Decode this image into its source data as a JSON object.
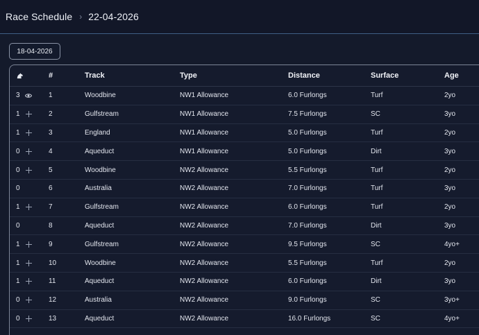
{
  "header": {
    "title": "Race Schedule",
    "separator": "›",
    "date": "22-04-2026"
  },
  "filter": {
    "date": "18-04-2026"
  },
  "table": {
    "columns": [
      "",
      "#",
      "Track",
      "Type",
      "Distance",
      "Surface",
      "Age"
    ],
    "rows": [
      {
        "count": "3",
        "icon": "eye-icon",
        "num": "1",
        "track": "Woodbine",
        "type": "NW1 Allowance",
        "distance": "6.0 Furlongs",
        "surface": "Turf",
        "age": "2yo"
      },
      {
        "count": "1",
        "icon": "plus-icon",
        "num": "2",
        "track": "Gulfstream",
        "type": "NW1 Allowance",
        "distance": "7.5 Furlongs",
        "surface": "SC",
        "age": "3yo"
      },
      {
        "count": "1",
        "icon": "plus-icon",
        "num": "3",
        "track": "England",
        "type": "NW1 Allowance",
        "distance": "5.0 Furlongs",
        "surface": "Turf",
        "age": "2yo"
      },
      {
        "count": "0",
        "icon": "plus-icon",
        "num": "4",
        "track": "Aqueduct",
        "type": "NW1 Allowance",
        "distance": "5.0 Furlongs",
        "surface": "Dirt",
        "age": "3yo"
      },
      {
        "count": "0",
        "icon": "plus-icon",
        "num": "5",
        "track": "Woodbine",
        "type": "NW2 Allowance",
        "distance": "5.5 Furlongs",
        "surface": "Turf",
        "age": "2yo"
      },
      {
        "count": "0",
        "icon": "",
        "num": "6",
        "track": "Australia",
        "type": "NW2 Allowance",
        "distance": "7.0 Furlongs",
        "surface": "Turf",
        "age": "3yo"
      },
      {
        "count": "1",
        "icon": "plus-icon",
        "num": "7",
        "track": "Gulfstream",
        "type": "NW2 Allowance",
        "distance": "6.0 Furlongs",
        "surface": "Turf",
        "age": "2yo"
      },
      {
        "count": "0",
        "icon": "",
        "num": "8",
        "track": "Aqueduct",
        "type": "NW2 Allowance",
        "distance": "7.0 Furlongs",
        "surface": "Dirt",
        "age": "3yo"
      },
      {
        "count": "1",
        "icon": "plus-icon",
        "num": "9",
        "track": "Gulfstream",
        "type": "NW2 Allowance",
        "distance": "9.5 Furlongs",
        "surface": "SC",
        "age": "4yo+"
      },
      {
        "count": "1",
        "icon": "plus-icon",
        "num": "10",
        "track": "Woodbine",
        "type": "NW2 Allowance",
        "distance": "5.5 Furlongs",
        "surface": "Turf",
        "age": "2yo"
      },
      {
        "count": "1",
        "icon": "plus-icon",
        "num": "11",
        "track": "Aqueduct",
        "type": "NW2 Allowance",
        "distance": "6.0 Furlongs",
        "surface": "Dirt",
        "age": "3yo"
      },
      {
        "count": "0",
        "icon": "plus-icon",
        "num": "12",
        "track": "Australia",
        "type": "NW2 Allowance",
        "distance": "9.0 Furlongs",
        "surface": "SC",
        "age": "3yo+"
      },
      {
        "count": "0",
        "icon": "plus-icon",
        "num": "13",
        "track": "Aqueduct",
        "type": "NW2 Allowance",
        "distance": "16.0 Furlongs",
        "surface": "SC",
        "age": "4yo+"
      }
    ]
  },
  "colors": {
    "background": "#141a2b",
    "header_border": "#3f5f86",
    "row_divider": "#262e42"
  }
}
